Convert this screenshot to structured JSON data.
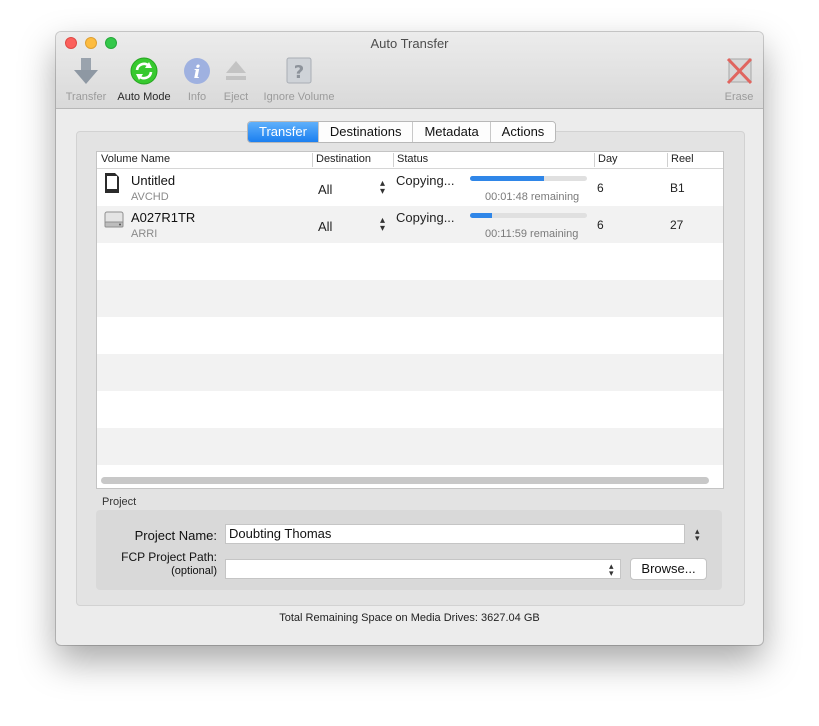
{
  "window": {
    "title": "Auto Transfer"
  },
  "toolbar": {
    "transfer": "Transfer",
    "auto_mode": "Auto Mode",
    "info": "Info",
    "eject": "Eject",
    "ignore_volume": "Ignore Volume",
    "erase": "Erase"
  },
  "tabs": [
    "Transfer",
    "Destinations",
    "Metadata",
    "Actions"
  ],
  "table": {
    "headers": [
      "Volume Name",
      "Destination",
      "Status",
      "Day",
      "Reel"
    ],
    "rows": [
      {
        "name": "Untitled",
        "sub": "AVCHD",
        "destination": "All",
        "status": "Copying...",
        "progress": 0.63,
        "remaining": "00:01:48 remaining",
        "day": "6",
        "reel": "B1",
        "icon": "sd-card-icon"
      },
      {
        "name": "A027R1TR",
        "sub": "ARRI",
        "destination": "All",
        "status": "Copying...",
        "progress": 0.19,
        "remaining": "00:11:59 remaining",
        "day": "6",
        "reel": "27",
        "icon": "hard-drive-icon"
      }
    ]
  },
  "project": {
    "section": "Project",
    "name_label": "Project Name:",
    "name_value": "Doubting Thomas",
    "fcp_label": "FCP Project Path:",
    "fcp_optional": "(optional)",
    "fcp_value": "",
    "browse": "Browse..."
  },
  "footer": "Total Remaining Space on Media Drives: 3627.04 GB",
  "colors": {
    "accent": "#1b7ff0",
    "progress": "#2f86e8",
    "auto_mode": "#2fc42b"
  }
}
